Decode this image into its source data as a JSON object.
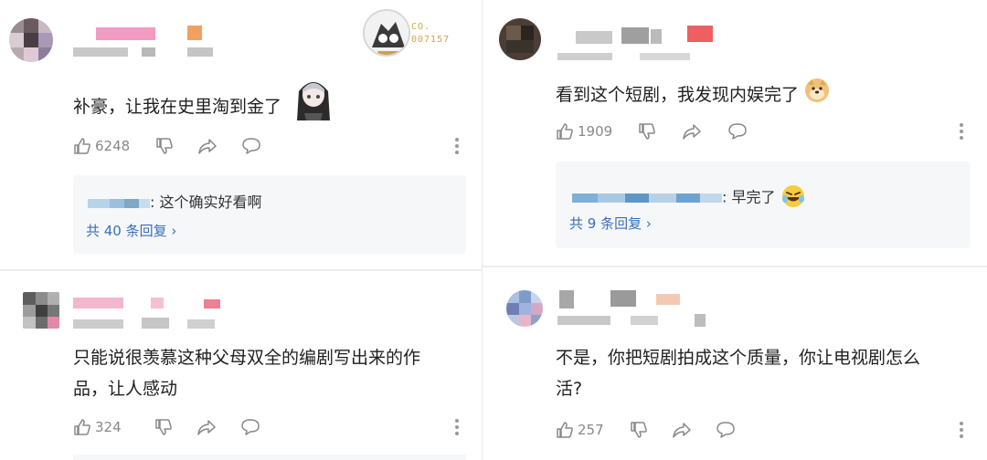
{
  "comments": [
    {
      "id": "c1",
      "text": "补豪，让我在史里淘到金了",
      "likes": "6248",
      "reply": {
        "text": ": 这个确实好看啊",
        "more": "共 40 条回复 ›"
      },
      "badge": {
        "line1": "CO.",
        "line2": "007157"
      },
      "sticker": "anime-girl-sticker"
    },
    {
      "id": "c2",
      "text_line1": "只能说很羡慕这种父母双全的编剧写出来的作",
      "text_line2": "品，让人感动",
      "likes": "324"
    },
    {
      "id": "c3",
      "text": "看到这个短剧，我发现内娱完了",
      "likes": "1909",
      "reply": {
        "text": ": 早完了",
        "more": "共 9 条回复 ›"
      },
      "emoji": "doge-emoji"
    },
    {
      "id": "c4",
      "text_line1": "不是，你把短剧拍成这个质量，你让电视剧怎么",
      "text_line2": "活?",
      "likes": "257"
    }
  ],
  "icons": [
    "thumbs-up-icon",
    "thumbs-down-icon",
    "share-icon",
    "comment-icon",
    "more-icon"
  ],
  "colors": {
    "reply_link": "#3a6fb8",
    "reply_bg": "#f6f7f9",
    "action_gray": "#888888"
  }
}
